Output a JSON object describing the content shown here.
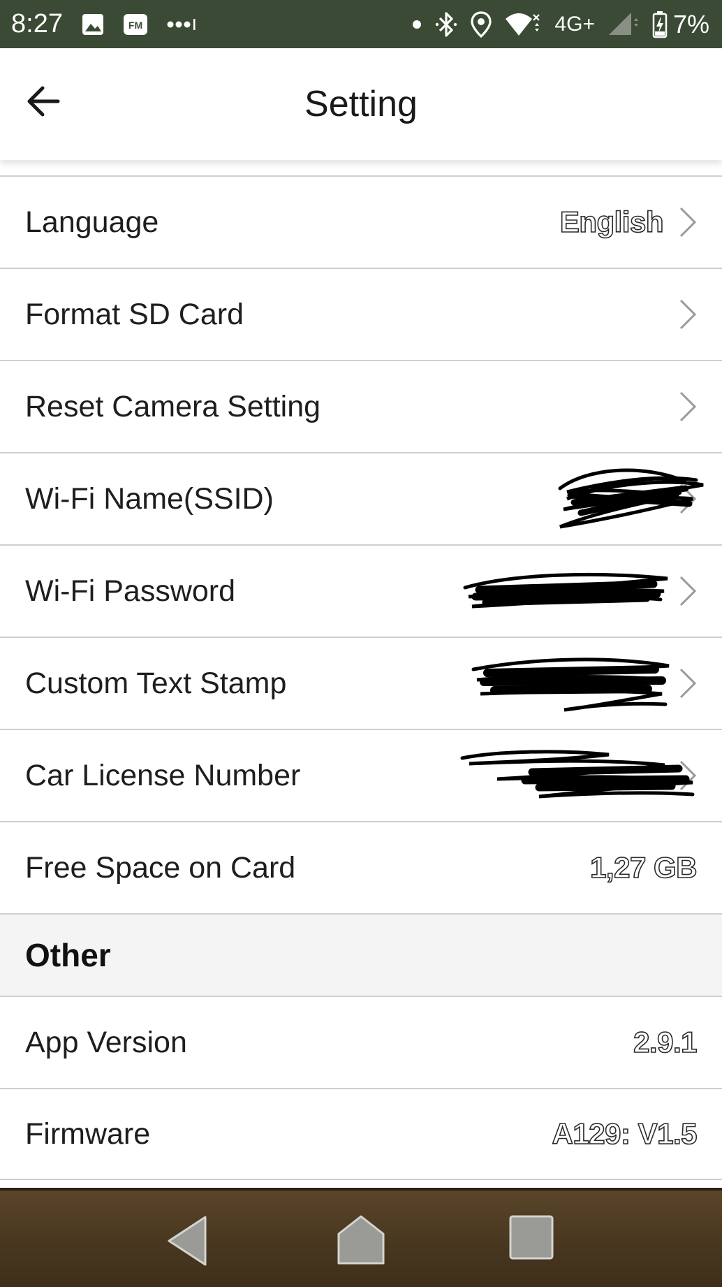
{
  "status_bar": {
    "time": "8:27",
    "network": "4G+",
    "battery": "7%",
    "icons": [
      "image-icon",
      "fm-radio-icon",
      "more-dots-icon",
      "dot-icon",
      "bluetooth-icon",
      "location-icon",
      "wifi-icon",
      "signal-icon",
      "battery-charging-icon"
    ]
  },
  "app_bar": {
    "title": "Setting",
    "back_icon": "arrow-left-icon"
  },
  "settings": {
    "rows": [
      {
        "label": "Language",
        "value": "English",
        "chevron": true
      },
      {
        "label": "Format SD Card",
        "value": "",
        "chevron": true
      },
      {
        "label": "Reset Camera Setting",
        "value": "",
        "chevron": true
      },
      {
        "label": "Wi-Fi Name(SSID)",
        "value": "",
        "chevron": true,
        "redacted": true
      },
      {
        "label": "Wi-Fi Password",
        "value": "",
        "chevron": true,
        "redacted": true
      },
      {
        "label": "Custom Text Stamp",
        "value": "",
        "chevron": true,
        "redacted": true
      },
      {
        "label": "Car License Number",
        "value": "",
        "chevron": true,
        "redacted": true
      },
      {
        "label": "Free Space on Card",
        "value": "1,27 GB",
        "chevron": false
      }
    ]
  },
  "other": {
    "section_title": "Other",
    "rows": [
      {
        "label": "App Version",
        "value": "2.9.1"
      },
      {
        "label": "Firmware",
        "value": "A129: V1.5"
      }
    ]
  },
  "nav_bar": {
    "buttons": [
      "back-triangle-icon",
      "home-icon",
      "recents-square-icon"
    ]
  },
  "colors": {
    "status_bar_bg": "#3b4a34",
    "nav_bar_bg": "#4e3b22",
    "divider": "#cfcfcf",
    "section_bg": "#f4f4f4"
  }
}
